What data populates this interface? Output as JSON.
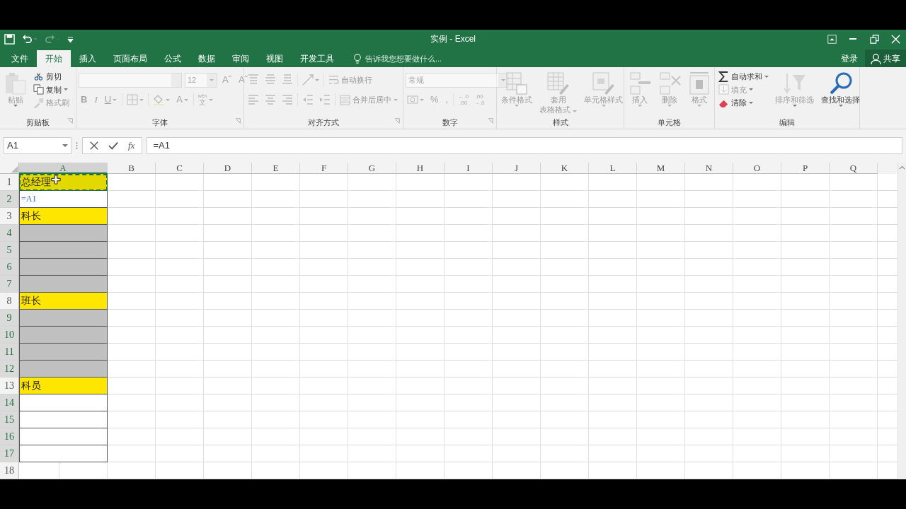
{
  "window": {
    "title": "实例 - Excel"
  },
  "quick_access": [
    {
      "kind": "save",
      "disabled": false
    },
    {
      "kind": "undo",
      "disabled": false
    },
    {
      "kind": "redo",
      "disabled": true
    },
    {
      "kind": "customize",
      "disabled": false
    }
  ],
  "window_controls": [
    {
      "kind": "ribbon-display"
    },
    {
      "kind": "minimize"
    },
    {
      "kind": "restore"
    },
    {
      "kind": "close"
    }
  ],
  "tabs": [
    {
      "label": "文件",
      "selected": false
    },
    {
      "label": "开始",
      "selected": true
    },
    {
      "label": "插入",
      "selected": false
    },
    {
      "label": "页面布局",
      "selected": false
    },
    {
      "label": "公式",
      "selected": false
    },
    {
      "label": "数据",
      "selected": false
    },
    {
      "label": "审阅",
      "selected": false
    },
    {
      "label": "视图",
      "selected": false
    },
    {
      "label": "开发工具",
      "selected": false
    }
  ],
  "tell_me": "告诉我您想要做什么...",
  "account": {
    "sign_in": "登录",
    "share": "共享"
  },
  "ribbon": {
    "groups": [
      {
        "label": "剪贴板",
        "launcher": true,
        "disabled": false,
        "items": [
          {
            "kind": "paste",
            "label": "粘贴",
            "disabled": true,
            "caret": true
          },
          {
            "kind": "stack",
            "items": [
              {
                "kind": "cut",
                "label": "剪切",
                "disabled": false
              },
              {
                "kind": "copy",
                "label": "复制",
                "disabled": false,
                "caret": true
              },
              {
                "kind": "format-painter",
                "label": "格式刷",
                "disabled": true
              }
            ]
          }
        ]
      },
      {
        "label": "字体",
        "launcher": true,
        "disabled": true,
        "items": [
          {
            "kind": "stack",
            "items": [
              {
                "kind": "bar",
                "items": [
                  {
                    "kind": "font-name"
                  },
                  {
                    "kind": "font-size",
                    "value": "12",
                    "caret": true
                  },
                  {
                    "kind": "grow-font",
                    "label": "Aˆ"
                  },
                  {
                    "kind": "shrink-font",
                    "label": "Aˇ"
                  }
                ]
              },
              {
                "kind": "bar",
                "items": [
                  {
                    "kind": "bold",
                    "label": "B"
                  },
                  {
                    "kind": "italic",
                    "label": "I"
                  },
                  {
                    "kind": "underline",
                    "label": "U",
                    "caret": true
                  },
                  {
                    "kind": "sep"
                  },
                  {
                    "kind": "borders",
                    "caret": true
                  },
                  {
                    "kind": "sep"
                  },
                  {
                    "kind": "fill-color",
                    "caret": true
                  },
                  {
                    "kind": "font-color",
                    "label": "A",
                    "caret": true
                  },
                  {
                    "kind": "sep"
                  },
                  {
                    "kind": "phonetic",
                    "top": "wén",
                    "bottom": "文",
                    "caret": true
                  }
                ]
              }
            ]
          }
        ]
      },
      {
        "label": "对齐方式",
        "launcher": true,
        "disabled": true,
        "items": [
          {
            "kind": "stack",
            "items": [
              {
                "kind": "bar",
                "items": [
                  {
                    "kind": "align-top"
                  },
                  {
                    "kind": "align-middle"
                  },
                  {
                    "kind": "align-bottom"
                  },
                  {
                    "kind": "sep"
                  },
                  {
                    "kind": "orientation",
                    "caret": true
                  },
                  {
                    "kind": "sep"
                  },
                  {
                    "kind": "wrap-text",
                    "label": "自动换行"
                  }
                ]
              },
              {
                "kind": "bar",
                "items": [
                  {
                    "kind": "align-left"
                  },
                  {
                    "kind": "align-center"
                  },
                  {
                    "kind": "align-right"
                  },
                  {
                    "kind": "sep"
                  },
                  {
                    "kind": "outdent"
                  },
                  {
                    "kind": "indent"
                  },
                  {
                    "kind": "sep"
                  },
                  {
                    "kind": "merge-center",
                    "label": "合并后居中",
                    "caret": true
                  }
                ]
              }
            ]
          }
        ]
      },
      {
        "label": "数字",
        "launcher": true,
        "disabled": true,
        "items": [
          {
            "kind": "stack",
            "items": [
              {
                "kind": "bar",
                "items": [
                  {
                    "kind": "number-format",
                    "value": "常规",
                    "caret": true
                  }
                ]
              },
              {
                "kind": "bar",
                "items": [
                  {
                    "kind": "currency",
                    "caret": true
                  },
                  {
                    "kind": "percent",
                    "label": "%"
                  },
                  {
                    "kind": "comma",
                    "label": ","
                  },
                  {
                    "kind": "sep"
                  },
                  {
                    "kind": "increase-decimal",
                    "top": "←.0",
                    "bottom": ".00"
                  },
                  {
                    "kind": "decrease-decimal",
                    "top": ".00",
                    "bottom": "→.0"
                  }
                ]
              }
            ]
          }
        ]
      },
      {
        "label": "样式",
        "disabled": true,
        "items": [
          {
            "kind": "conditional-format",
            "label": "条件格式",
            "caret": true
          },
          {
            "kind": "format-as-table",
            "label": "套用",
            "label2": "表格格式",
            "caret": true
          },
          {
            "kind": "cell-styles",
            "label": "单元格样式",
            "caret": true
          }
        ]
      },
      {
        "label": "单元格",
        "disabled": true,
        "items": [
          {
            "kind": "insert-cells",
            "label": "插入",
            "caret": true
          },
          {
            "kind": "delete-cells",
            "label": "删除",
            "caret": true
          },
          {
            "kind": "format-cells",
            "label": "格式",
            "caret": true
          }
        ]
      },
      {
        "label": "编辑",
        "disabled": false,
        "items": [
          {
            "kind": "stack",
            "items": [
              {
                "kind": "autosum",
                "label": "自动求和",
                "disabled": false,
                "caret": true
              },
              {
                "kind": "fill",
                "label": "填充",
                "disabled": true,
                "caret": true
              },
              {
                "kind": "clear",
                "label": "清除",
                "disabled": false,
                "caret": true
              }
            ]
          },
          {
            "kind": "sort-filter",
            "label": "排序和筛选",
            "disabled": true,
            "caret": true
          },
          {
            "kind": "find-select",
            "label": "查找和选择",
            "disabled": false,
            "caret": true
          }
        ]
      }
    ]
  },
  "formula_bar": {
    "name_box": "A1",
    "fx": "fx",
    "formula": "=A1"
  },
  "columns": [
    {
      "label": "A",
      "selected": true
    },
    {
      "label": "B",
      "selected": false
    },
    {
      "label": "C",
      "selected": false
    },
    {
      "label": "D",
      "selected": false
    },
    {
      "label": "E",
      "selected": false
    },
    {
      "label": "F",
      "selected": false
    },
    {
      "label": "G",
      "selected": false
    },
    {
      "label": "H",
      "selected": false
    },
    {
      "label": "I",
      "selected": false
    },
    {
      "label": "J",
      "selected": false
    },
    {
      "label": "K",
      "selected": false
    },
    {
      "label": "L",
      "selected": false
    },
    {
      "label": "M",
      "selected": false
    },
    {
      "label": "N",
      "selected": false
    },
    {
      "label": "O",
      "selected": false
    },
    {
      "label": "P",
      "selected": false
    },
    {
      "label": "Q",
      "selected": false
    }
  ],
  "rows": [
    {
      "label": "1",
      "selected": false,
      "cell": {
        "kind": "text",
        "text": "总经理",
        "color": "#e3d800",
        "copy_marquee": true,
        "pointer": true
      }
    },
    {
      "label": "2",
      "selected": true,
      "cell": {
        "kind": "formula",
        "text": "=A1",
        "color": "#ffffff"
      }
    },
    {
      "label": "3",
      "selected": false,
      "cell": {
        "kind": "text",
        "text": "科长",
        "color": "#ffe600"
      }
    },
    {
      "label": "4",
      "selected": true,
      "cell": {
        "kind": "text",
        "color": "#c0c0c0"
      }
    },
    {
      "label": "5",
      "selected": true,
      "cell": {
        "kind": "text",
        "color": "#c0c0c0"
      }
    },
    {
      "label": "6",
      "selected": true,
      "cell": {
        "kind": "text",
        "color": "#c0c0c0"
      }
    },
    {
      "label": "7",
      "selected": true,
      "cell": {
        "kind": "text",
        "color": "#c0c0c0"
      }
    },
    {
      "label": "8",
      "selected": false,
      "cell": {
        "kind": "text",
        "text": "班长",
        "color": "#ffe600"
      }
    },
    {
      "label": "9",
      "selected": true,
      "cell": {
        "kind": "text",
        "color": "#c0c0c0"
      }
    },
    {
      "label": "10",
      "selected": true,
      "cell": {
        "kind": "text",
        "color": "#c0c0c0"
      }
    },
    {
      "label": "11",
      "selected": true,
      "cell": {
        "kind": "text",
        "color": "#c0c0c0"
      }
    },
    {
      "label": "12",
      "selected": true,
      "cell": {
        "kind": "text",
        "color": "#c0c0c0"
      }
    },
    {
      "label": "13",
      "selected": false,
      "cell": {
        "kind": "text",
        "text": "科员",
        "color": "#ffe600"
      }
    },
    {
      "label": "14",
      "selected": true,
      "cell": {
        "kind": "text",
        "color": "#ffffff"
      }
    },
    {
      "label": "15",
      "selected": true,
      "cell": {
        "kind": "text",
        "color": "#ffffff"
      }
    },
    {
      "label": "16",
      "selected": true,
      "cell": {
        "kind": "text",
        "color": "#ffffff"
      }
    },
    {
      "label": "17",
      "selected": true,
      "cell": {
        "kind": "text",
        "color": "#ffffff"
      }
    },
    {
      "label": "18",
      "selected": false
    }
  ]
}
